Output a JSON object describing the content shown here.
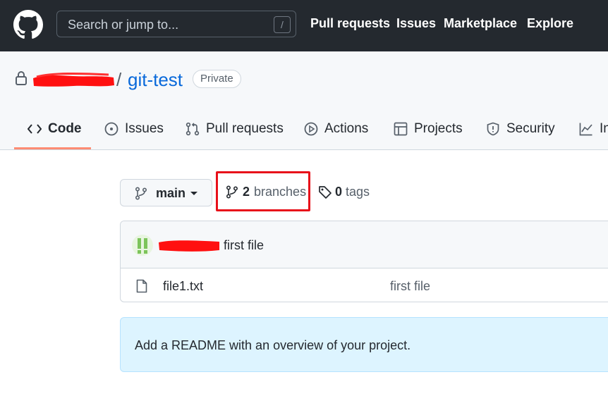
{
  "header": {
    "search_placeholder": "Search or jump to...",
    "search_shortcut": "/",
    "nav": [
      "Pull requests",
      "Issues",
      "Marketplace",
      "Explore"
    ]
  },
  "repo": {
    "separator": "/",
    "name": "git-test",
    "visibility": "Private"
  },
  "tabs": [
    {
      "label": "Code",
      "icon": "code-icon",
      "selected": true
    },
    {
      "label": "Issues",
      "icon": "issue-opened-icon"
    },
    {
      "label": "Pull requests",
      "icon": "git-pull-request-icon"
    },
    {
      "label": "Actions",
      "icon": "play-icon"
    },
    {
      "label": "Projects",
      "icon": "table-icon"
    },
    {
      "label": "Security",
      "icon": "shield-icon"
    },
    {
      "label": "In",
      "icon": "graph-icon"
    }
  ],
  "branch": {
    "current": "main",
    "branches_count": "2",
    "branches_label": "branches",
    "tags_count": "0",
    "tags_label": "tags"
  },
  "latest_commit": {
    "message": "first file"
  },
  "files": [
    {
      "name": "file1.txt",
      "commit": "first file"
    }
  ],
  "readme_notice": "Add a README with an overview of your project.",
  "colors": {
    "header_bg": "#24292f",
    "link": "#0969da",
    "tab_underline": "#fd8c73",
    "highlight": "#e8101a",
    "notice_bg": "#ddf4ff"
  }
}
